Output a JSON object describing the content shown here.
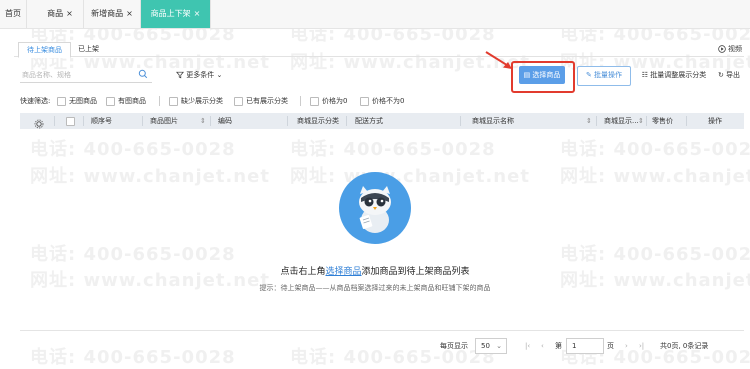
{
  "top_tabs": [
    {
      "label": "首页"
    },
    {
      "label": "商品",
      "close": "×"
    },
    {
      "label": "新增商品",
      "close": "×"
    },
    {
      "label": "商品上下架",
      "close": "×"
    }
  ],
  "sub_tabs": [
    {
      "label": "待上架商品"
    },
    {
      "label": "已上架"
    }
  ],
  "video_label": "视频",
  "search": {
    "placeholder": "商品名称、规格"
  },
  "more_filters": "更多条件",
  "actions": {
    "select_goods": "选择商品",
    "batch_ops": "批量操作",
    "batch_adjust": "批量调整展示分类",
    "export": "导出"
  },
  "quick_filter": {
    "label": "快速筛选:",
    "options": [
      "无图商品",
      "有图商品",
      "缺少展示分类",
      "已有展示分类",
      "价格为0",
      "价格不为0"
    ]
  },
  "table": {
    "columns": [
      "顺序号",
      "商品图片",
      "编码",
      "商城显示分类",
      "配送方式",
      "商城显示名称",
      "商城显示...",
      "零售价",
      "操作"
    ]
  },
  "empty": {
    "title_before": "点击右上角",
    "title_link": "选择商品",
    "title_after": "添加商品到待上架商品列表",
    "tip": "提示：待上架商品——从商品档案选择过来的未上架商品和旺铺下架的商品"
  },
  "pagination": {
    "per_page_label": "每页显示",
    "per_page": "50",
    "page_prefix": "第",
    "page": "1",
    "page_suffix": "页",
    "total": "共0页, 0条记录"
  },
  "watermark": {
    "phone": "电话: 400-665-0028",
    "site": "网址: www.chanjet.net"
  },
  "colors": {
    "active_tab": "#3fc5b0",
    "primary": "#5b9ee8",
    "highlight": "#e23b2e"
  }
}
